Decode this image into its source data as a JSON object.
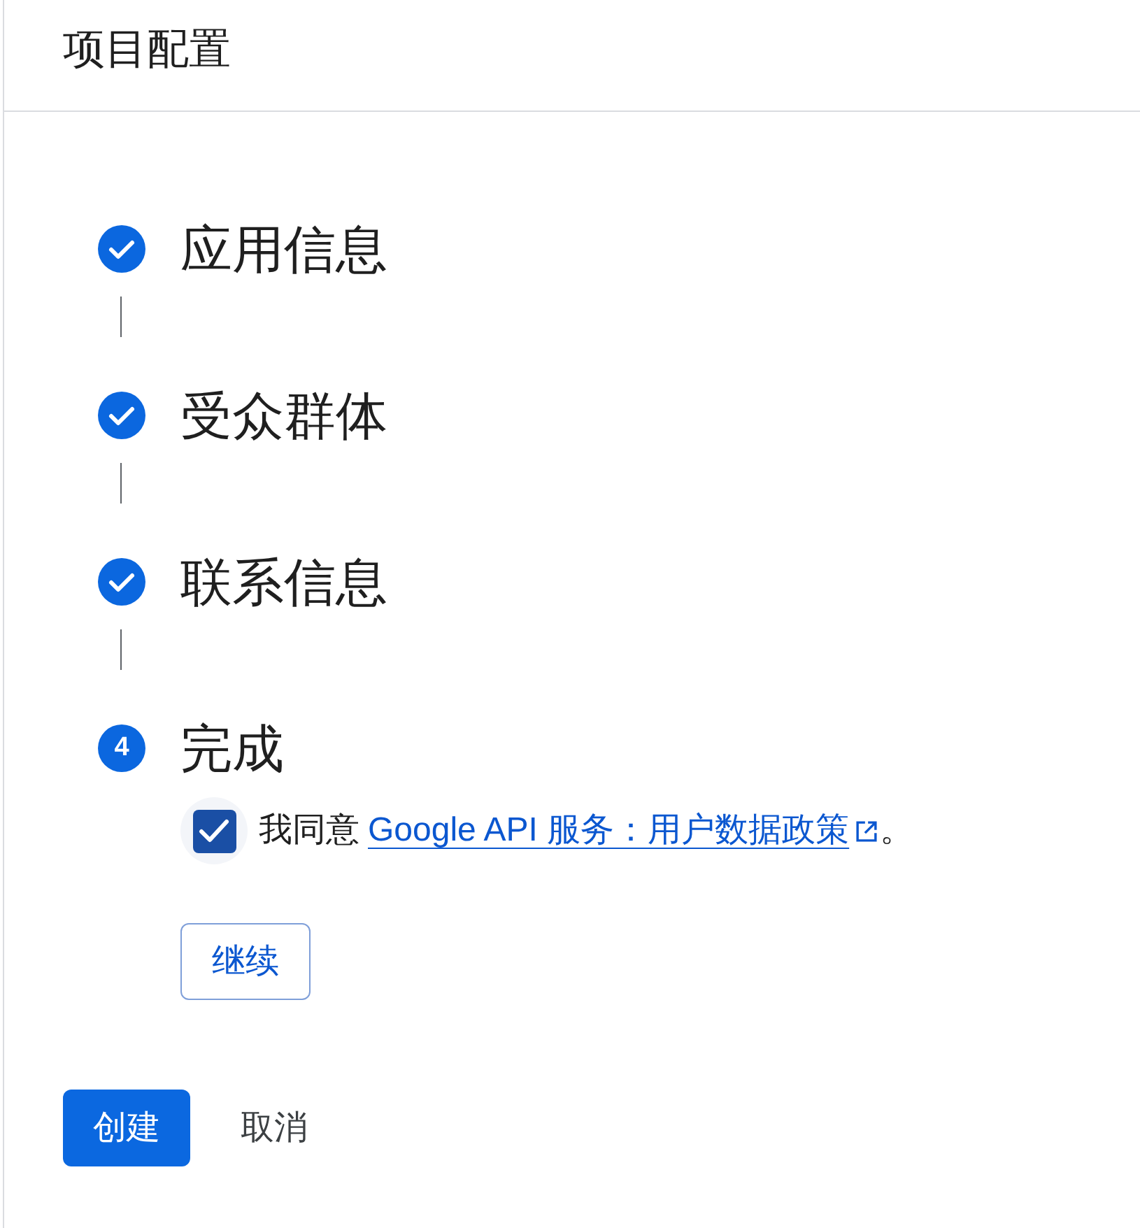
{
  "header": {
    "title": "项目配置"
  },
  "steps": [
    {
      "title": "应用信息",
      "completed": true
    },
    {
      "title": "受众群体",
      "completed": true
    },
    {
      "title": "联系信息",
      "completed": true
    },
    {
      "title": "完成",
      "completed": false,
      "number": "4"
    }
  ],
  "agreement": {
    "checked": true,
    "prefix": "我同意",
    "link": "Google API 服务：用户数据政策",
    "suffix": "。"
  },
  "continue_button": {
    "label": "继续"
  },
  "actions": [
    {
      "kind": "primary",
      "label": "创建"
    },
    {
      "kind": "text",
      "label": "取消"
    }
  ]
}
